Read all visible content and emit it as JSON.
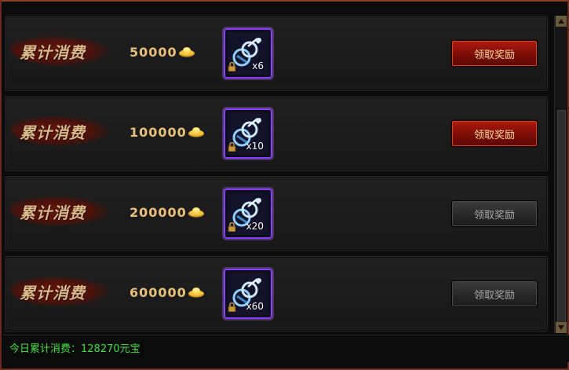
{
  "rows": [
    {
      "label": "累计消费",
      "amount": "50000",
      "item_count": "x6",
      "button_label": "领取奖励",
      "button_state": "active"
    },
    {
      "label": "累计消费",
      "amount": "100000",
      "item_count": "x10",
      "button_label": "领取奖励",
      "button_state": "active"
    },
    {
      "label": "累计消费",
      "amount": "200000",
      "item_count": "x20",
      "button_label": "领取奖励",
      "button_state": "disabled"
    },
    {
      "label": "累计消费",
      "amount": "600000",
      "item_count": "x60",
      "button_label": "领取奖励",
      "button_state": "disabled"
    }
  ],
  "footer": {
    "label": "今日累计消费：",
    "value": "128270",
    "unit": "元宝"
  },
  "icons": {
    "currency": "gold-ingot-icon",
    "item": "key-ring-item-icon",
    "lock": "lock-icon"
  },
  "colors": {
    "label": "#d8b98a",
    "amount": "#e8c07a",
    "active_button": "#a0150c",
    "footer_text": "#3ee03a",
    "item_glow": "#9a4cff"
  }
}
